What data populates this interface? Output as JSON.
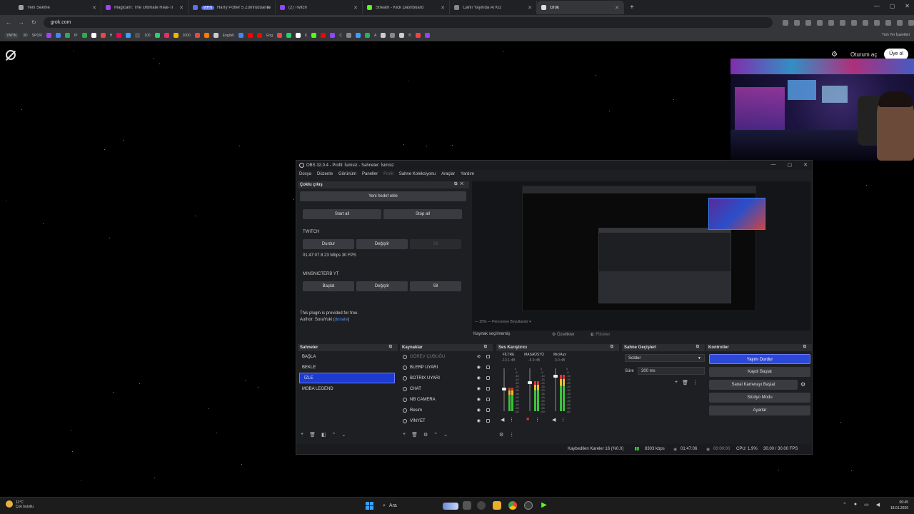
{
  "browser": {
    "tabs": [
      {
        "label": "Yeni Sekme",
        "color": "#9aa0a6"
      },
      {
        "label": "Magicam: The Ultimate Real-Ti",
        "color": "#a142f4"
      },
      {
        "label": "Harry Potter 5 Zümrüdüanka Y",
        "color": "#5b6ef5",
        "badge": "WHN"
      },
      {
        "label": "(2) Twitch",
        "color": "#9146ff"
      },
      {
        "label": "Stream - Kick Dashboard",
        "color": "#53fc18"
      },
      {
        "label": "Canlı Yayında Al Kız",
        "color": "#888888"
      },
      {
        "label": "Grok",
        "color": "#dddddd",
        "active": true
      }
    ],
    "url": "grok.com",
    "bookmarks_left": [
      "YAYIN",
      "3D",
      "SPOR"
    ],
    "bookmarks_text": [
      "IP",
      "H",
      "100",
      "1000",
      "English",
      "Eng",
      "K",
      "C",
      "A",
      "B"
    ],
    "bookmarks_right": "Tüm Yer İşaretleri"
  },
  "grok": {
    "login": "Oturum aç",
    "signup": "Üye ol"
  },
  "obs": {
    "title": "OBS 32.0.4 - Profil: İsimsiz - Sahneler: İsimsiz",
    "menu": [
      "Dosya",
      "Düzenle",
      "Görünüm",
      "Paneller",
      "Profil",
      "Sahne Koleksiyonu",
      "Araçlar",
      "Yardım"
    ],
    "multi_output": {
      "title": "Çoklu çıkış",
      "add_target": "Yeni hedef ekle",
      "start_all": "Start all",
      "stop_all": "Stop all",
      "targets": [
        {
          "name": "TWITCH",
          "btn1": "Durdur",
          "btn2": "Değiştir",
          "btn3": "Sil",
          "stats": "01:47:07  8.23 Mbps  30 FPS"
        },
        {
          "name": "MINSNICTERB YT",
          "btn1": "Başlat",
          "btn2": "Değiştir",
          "btn3": "Sil"
        }
      ],
      "plugin_note": "This plugin is provided for free.",
      "author_prefix": "Author: SoraYuki (",
      "author_link": "donate",
      "author_suffix": ")"
    },
    "preview": {
      "zoom": "—  25%  —  Pencereye Boyutlandır  ▾"
    },
    "source_bar": {
      "none_selected": "Kaynak seçilmemiş",
      "properties": "Özellikler",
      "filters": "Filtreler"
    },
    "scenes": {
      "title": "Sahneler",
      "items": [
        "BAŞLA",
        "BEKLE",
        "İZLE",
        "MOBA LEGEND"
      ],
      "selected": "İZLE"
    },
    "sources": {
      "title": "Kaynaklar",
      "items": [
        "GÖREV ÇUBUĞU",
        "BLERP UYARI",
        "BOTRIX UYARI",
        "CHAT",
        "NB CAMERA",
        "Resim",
        "VİNYET"
      ]
    },
    "mixer": {
      "title": "Ses Karıştırıcı",
      "channels": [
        {
          "name": "FİLTRE",
          "db": "-13.1 dB",
          "level": 0.55
        },
        {
          "name": "MASAÜSTÜ",
          "db": "-6.9 dB",
          "level": 0.7
        },
        {
          "name": "Mic/Aux",
          "db": "0.0 dB",
          "level": 0.85
        }
      ],
      "scale": [
        "0",
        "-5",
        "-10",
        "-15",
        "-20",
        "-25",
        "-30",
        "-35",
        "-40",
        "-45",
        "-50",
        "-55",
        "-60"
      ]
    },
    "transitions": {
      "title": "Sahne Geçişleri",
      "selected": "Soldur",
      "duration_label": "Süre",
      "duration": "300 ms"
    },
    "controls": {
      "title": "Kontroller",
      "stop_stream": "Yayını Durdur",
      "start_record": "Kaydı Başlat",
      "virtual_cam": "Sanal Kamerayı Başlat",
      "studio_mode": "Stüdyo Modu",
      "settings": "Ayarlar"
    },
    "status": {
      "dropped": "Kaybedilen Kareler 16 (%0.0)",
      "bitrate": "8303 kbps",
      "stream_time": "01:47:06",
      "rec_time": "00:00:00",
      "cpu": "CPU: 1.9%",
      "fps": "30.00 / 30.00 FPS"
    }
  },
  "taskbar": {
    "weather_temp": "11°C",
    "weather_desc": "Çok bulutlu",
    "search": "Ara",
    "time": "00:45",
    "date": "18.01.2026"
  }
}
